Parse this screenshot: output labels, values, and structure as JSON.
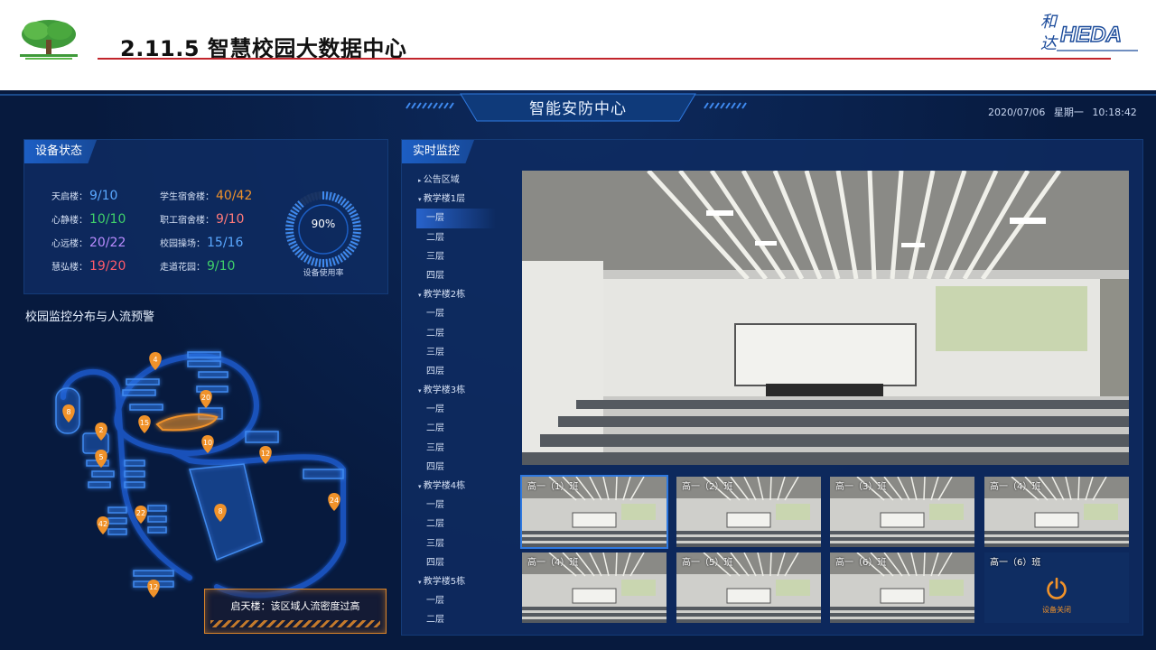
{
  "slide": {
    "title": "2.11.5  智慧校园大数据中心",
    "brand_logo_text": "HEDA",
    "brand_logo_chinese": [
      "和",
      "达"
    ]
  },
  "dashboard": {
    "title": "智能安防中心",
    "date": "2020/07/06",
    "weekday": "星期一",
    "time": "10:18:42"
  },
  "device_status": {
    "tab": "设备状态",
    "stats": [
      {
        "label": "天启楼：",
        "value": "9/10",
        "color": "#5aa8ff"
      },
      {
        "label": "心静楼：",
        "value": "10/10",
        "color": "#3fd06a"
      },
      {
        "label": "心远楼：",
        "value": "20/22",
        "color": "#b98cff"
      },
      {
        "label": "慧弘楼：",
        "value": "19/20",
        "color": "#ff5a6a"
      },
      {
        "label": "学生宿舍楼：",
        "value": "40/42",
        "color": "#f0922a"
      },
      {
        "label": "职工宿舍楼：",
        "value": "9/10",
        "color": "#ff7a7a"
      },
      {
        "label": "校园操场：",
        "value": "15/16",
        "color": "#5aa8ff"
      },
      {
        "label": "走道花园：",
        "value": "9/10",
        "color": "#3fd06a"
      }
    ],
    "usage_percent": "90%",
    "usage_fraction": 0.9,
    "usage_label": "设备使用率"
  },
  "map": {
    "title": "校园监控分布与人流预警",
    "pins": [
      "4",
      "8",
      "20",
      "15",
      "2",
      "10",
      "12",
      "5",
      "24",
      "22",
      "8",
      "42",
      "12"
    ],
    "alert": "启天楼：该区域人流密度过高"
  },
  "monitor": {
    "tab": "实时监控",
    "tree": [
      {
        "label": "公告区域",
        "kind": "group"
      },
      {
        "label": "教学楼1层",
        "kind": "group open"
      },
      {
        "label": "一层",
        "kind": "leaf active"
      },
      {
        "label": "二层",
        "kind": "leaf"
      },
      {
        "label": "三层",
        "kind": "leaf"
      },
      {
        "label": "四层",
        "kind": "leaf"
      },
      {
        "label": "教学楼2栋",
        "kind": "group open"
      },
      {
        "label": "一层",
        "kind": "leaf"
      },
      {
        "label": "二层",
        "kind": "leaf"
      },
      {
        "label": "三层",
        "kind": "leaf"
      },
      {
        "label": "四层",
        "kind": "leaf"
      },
      {
        "label": "教学楼3栋",
        "kind": "group open"
      },
      {
        "label": "一层",
        "kind": "leaf"
      },
      {
        "label": "二层",
        "kind": "leaf"
      },
      {
        "label": "三层",
        "kind": "leaf"
      },
      {
        "label": "四层",
        "kind": "leaf"
      },
      {
        "label": "教学楼4栋",
        "kind": "group open"
      },
      {
        "label": "一层",
        "kind": "leaf"
      },
      {
        "label": "二层",
        "kind": "leaf"
      },
      {
        "label": "三层",
        "kind": "leaf"
      },
      {
        "label": "四层",
        "kind": "leaf"
      },
      {
        "label": "教学楼5栋",
        "kind": "group open"
      },
      {
        "label": "一层",
        "kind": "leaf"
      },
      {
        "label": "二层",
        "kind": "leaf"
      }
    ],
    "thumbs": [
      "高一（1）班",
      "高一（2）班",
      "高一（3）班",
      "高一（4）班",
      "高一（4）班",
      "高一（5）班",
      "高一（6）班"
    ],
    "offline_thumb": {
      "label": "高一（6）班",
      "status": "设备关闭"
    }
  }
}
